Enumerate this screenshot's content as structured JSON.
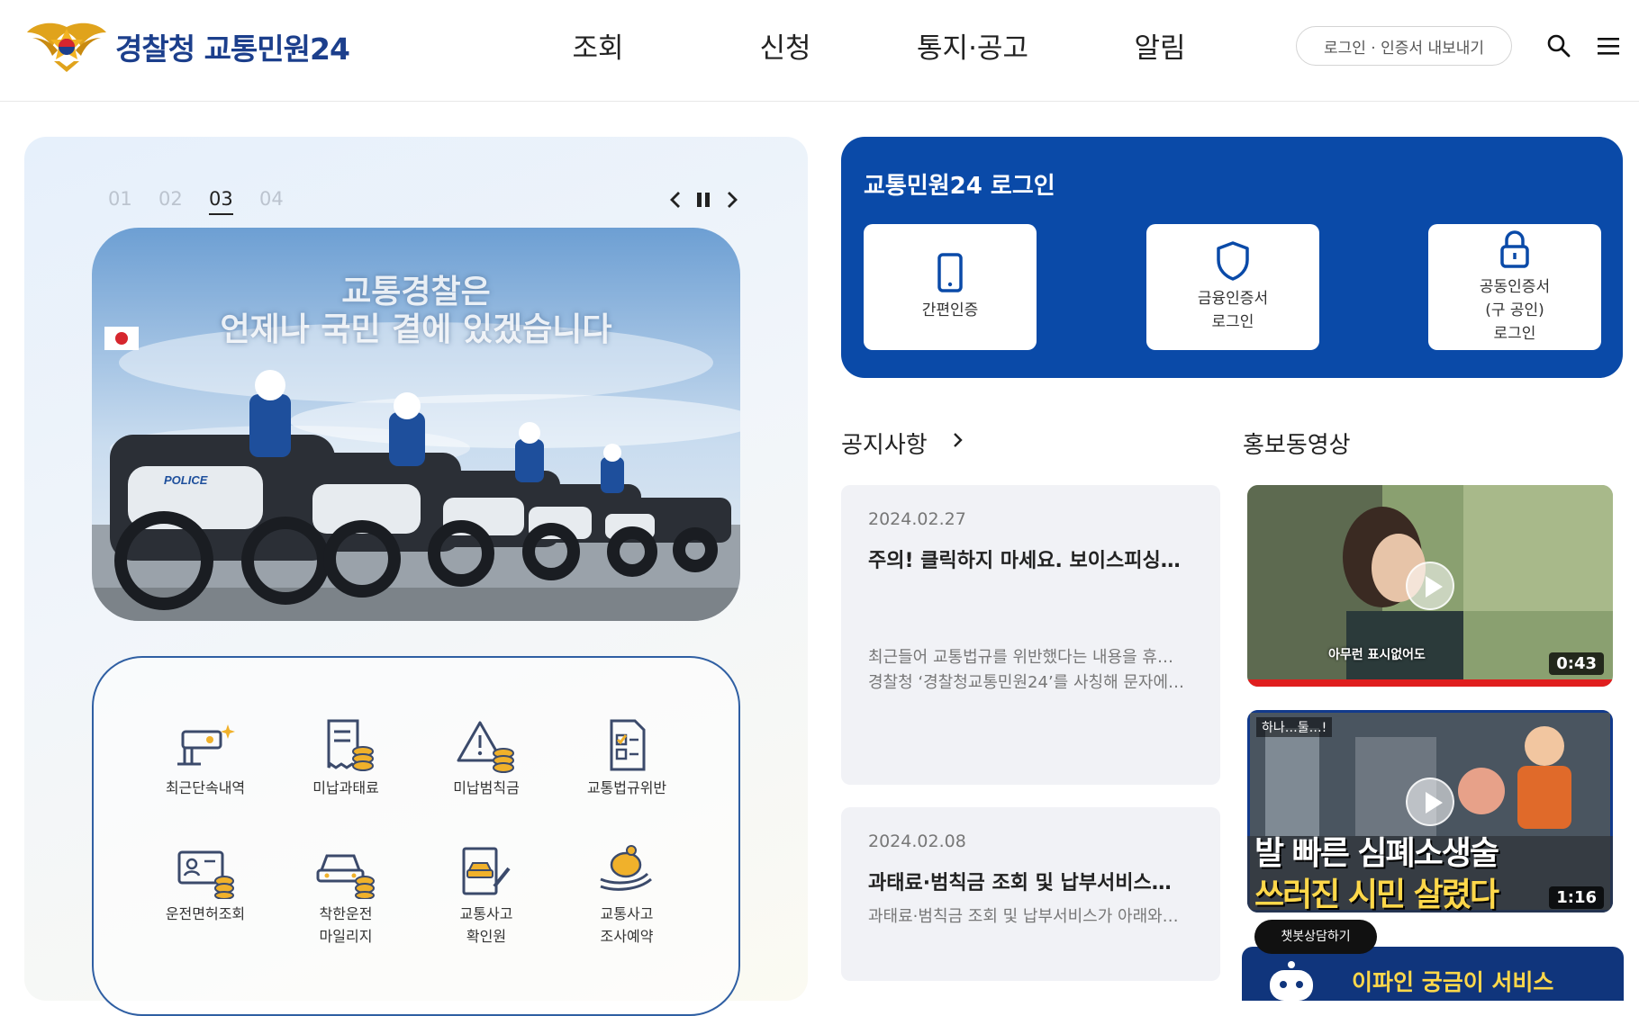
{
  "header": {
    "logo_text": "경찰청 교통민원24",
    "nav": [
      "조회",
      "신청",
      "통지·공고",
      "알림"
    ],
    "login_button": "로그인 · 인증서 내보내기"
  },
  "slider": {
    "numbers": [
      "01",
      "02",
      "03",
      "04"
    ],
    "active_index": 3,
    "hero_line1": "교통경찰은",
    "hero_line2": "언제나 국민 곁에 있겠습니다",
    "bike_label": "POLICE"
  },
  "quick_menu": [
    {
      "label": "최근단속내역",
      "icon": "cctv-icon"
    },
    {
      "label": "미납과태료",
      "icon": "receipt-coins-icon"
    },
    {
      "label": "미납범칙금",
      "icon": "warning-coins-icon"
    },
    {
      "label": "교통법규위반",
      "icon": "checklist-icon"
    },
    {
      "label": "운전면허조회",
      "icon": "id-card-icon"
    },
    {
      "label": "착한운전\n마일리지",
      "icon": "car-coins-icon"
    },
    {
      "label": "교통사고\n확인원",
      "icon": "accident-doc-icon"
    },
    {
      "label": "교통사고\n조사예약",
      "icon": "piggy-hand-icon"
    }
  ],
  "login": {
    "title": "교통민원24 로그인",
    "options": [
      {
        "label": "간편인증",
        "icon": "phone-icon"
      },
      {
        "label": "금융인증서\n로그인",
        "icon": "shield-icon"
      },
      {
        "label": "공동인증서\n(구 공인)\n로그인",
        "icon": "lock-icon"
      }
    ]
  },
  "notices": {
    "title": "공지사항",
    "items": [
      {
        "date": "2024.02.27",
        "title": "주의! 클릭하지 마세요. 보이스피싱…",
        "body1": "최근들어 교통법규를 위반했다는 내용을 휴…",
        "body2": "경찰청 ‘경찰청교통민원24’를 사칭해 문자에…"
      },
      {
        "date": "2024.02.08",
        "title": "과태료·범칙금 조회 및 납부서비스…",
        "body1": "과태료·범칙금 조회 및 납부서비스가 아래와…",
        "body2": ""
      }
    ]
  },
  "videos": {
    "title": "홍보동영상",
    "items": [
      {
        "duration": "0:43",
        "caption": "아무런 표시없어도"
      },
      {
        "duration": "1:16",
        "caption_line1": "발 빠른 심폐소생술",
        "caption_line2": "쓰러진 시민 살렸다",
        "tag": "하나…둘…!"
      }
    ]
  },
  "chatbot": {
    "bubble": "챗봇상담하기",
    "banner": "이파인 궁금이 서비스"
  },
  "colors": {
    "brand_blue": "#0a4aa8",
    "logo_navy": "#1c3f8c",
    "banner_yellow": "#ffd84a"
  }
}
